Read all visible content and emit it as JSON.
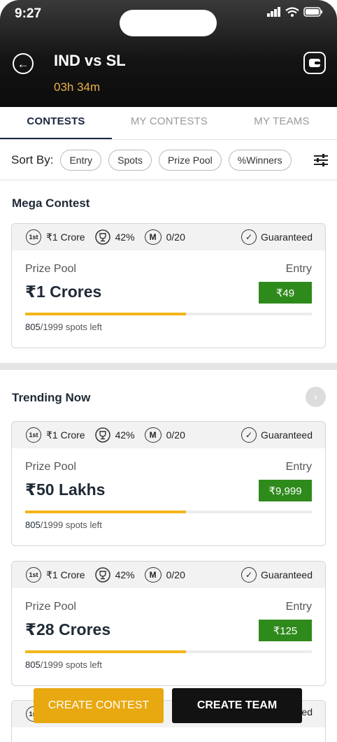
{
  "status_bar": {
    "time": "9:27"
  },
  "header": {
    "title": "IND vs SL",
    "timer": "03h 34m"
  },
  "tabs": [
    {
      "label": "CONTESTS"
    },
    {
      "label": "MY CONTESTS"
    },
    {
      "label": "MY TEAMS"
    }
  ],
  "sort": {
    "label": "Sort By:",
    "chips": [
      "Entry",
      "Spots",
      "Prize Pool",
      "%Winners"
    ]
  },
  "sections": {
    "mega": {
      "title": "Mega Contest"
    },
    "trending": {
      "title": "Trending Now"
    }
  },
  "card_common": {
    "rank_sup": "1st",
    "first_prize": "₹1 Crore",
    "win_pct": "42%",
    "m_label": "M",
    "max_entries": "0/20",
    "guaranteed": "Guaranteed",
    "prize_pool_label": "Prize Pool",
    "entry_label": "Entry",
    "spots_filled": "805",
    "spots_rest": "/1999 spots left"
  },
  "cards": [
    {
      "prize_pool": "₹1 Crores",
      "entry_fee": "₹49",
      "progress": 0.56
    },
    {
      "prize_pool": "₹50 Lakhs",
      "entry_fee": "₹9,999",
      "progress": 0.56
    },
    {
      "prize_pool": "₹28 Crores",
      "entry_fee": "₹125",
      "progress": 0.56
    }
  ],
  "actions": {
    "create_contest": "CREATE CONTEST",
    "create_team": "CREATE TEAM"
  },
  "colors": {
    "entry_green": "#2f8a1c",
    "progress_yellow": "#f2b61a",
    "create_contest_bg": "#e8a810",
    "timer_gold": "#e8b04a"
  }
}
